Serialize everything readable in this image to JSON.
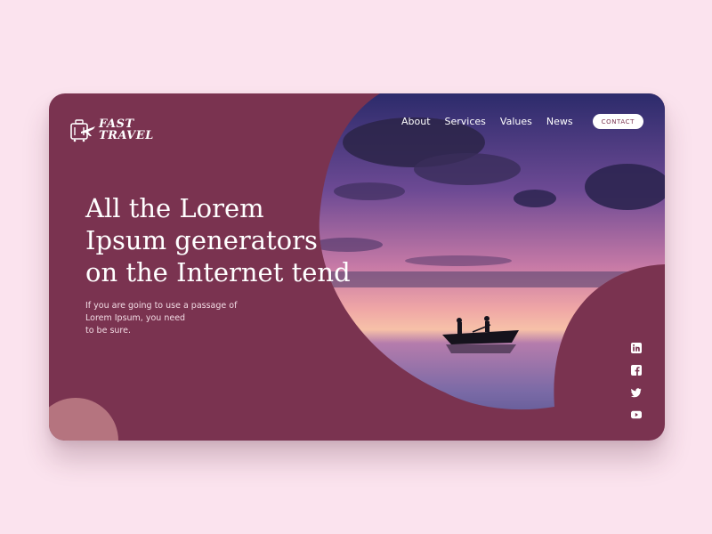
{
  "brand": {
    "line1": "FAST",
    "line2": "TRAVEL",
    "icon": "suitcase-plane-icon"
  },
  "nav": {
    "items": [
      {
        "label": "About"
      },
      {
        "label": "Services"
      },
      {
        "label": "Values"
      },
      {
        "label": "News"
      }
    ],
    "contact_label": "CONTACT"
  },
  "hero": {
    "headline": [
      "All the Lorem",
      "Ipsum generators",
      "on the Internet tend"
    ],
    "subtext": [
      "If you are going to use a passage of",
      "Lorem Ipsum, you need",
      "to be sure."
    ]
  },
  "social": [
    {
      "icon": "linkedin-icon"
    },
    {
      "icon": "facebook-icon"
    },
    {
      "icon": "twitter-icon"
    },
    {
      "icon": "youtube-icon"
    }
  ],
  "colors": {
    "page_background": "#fbe3ee",
    "card_background": "#7a3350",
    "accent_circle": "#b5747f",
    "text": "#ffffff"
  }
}
